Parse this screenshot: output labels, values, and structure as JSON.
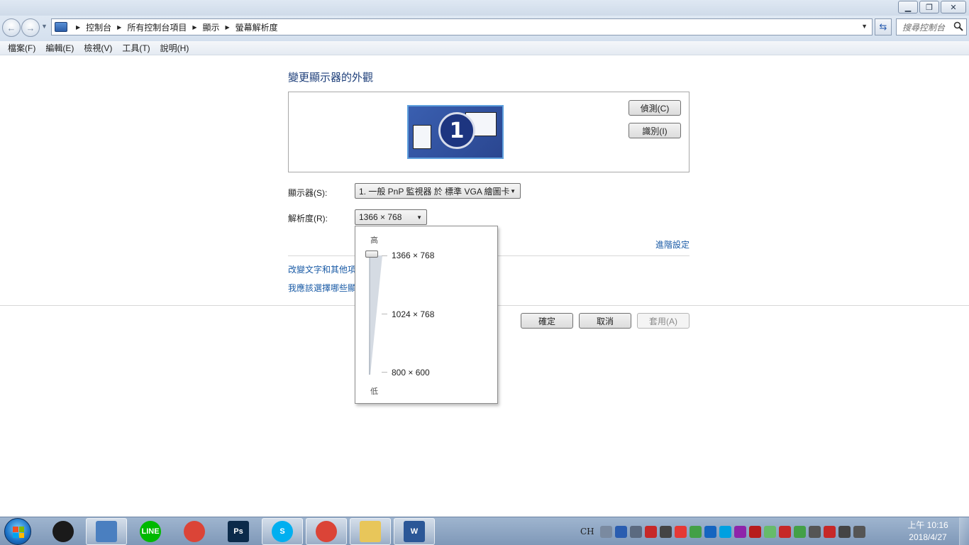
{
  "window": {
    "minimize_glyph": "▁",
    "restore_glyph": "❐",
    "close_glyph": "✕"
  },
  "address": {
    "back_glyph": "←",
    "forward_glyph": "→",
    "breadcrumb": [
      "控制台",
      "所有控制台項目",
      "顯示",
      "螢幕解析度"
    ],
    "search_placeholder": "搜尋控制台"
  },
  "menu": [
    "檔案(F)",
    "編輯(E)",
    "檢視(V)",
    "工具(T)",
    "說明(H)"
  ],
  "main": {
    "heading": "變更顯示器的外觀",
    "monitor_number": "1",
    "detect_button": "偵測(C)",
    "identify_button": "識別(I)",
    "display_label": "顯示器(S):",
    "display_value": "1. 一般 PnP 監視器 於 標準 VGA 繪圖卡",
    "resolution_label": "解析度(R):",
    "resolution_value": "1366 × 768",
    "advanced_link": "進階設定",
    "link_text_size": "改變文字和其他項",
    "link_which_display": "我應該選擇哪些顯",
    "ok_button": "確定",
    "cancel_button": "取消",
    "apply_button": "套用(A)"
  },
  "resolution_dropdown": {
    "high_label": "高",
    "low_label": "低",
    "options": [
      "1366 × 768",
      "1024 × 768",
      "800 × 600"
    ],
    "selected_index": 0
  },
  "taskbar": {
    "apps": [
      {
        "name": "clock-app",
        "label": "",
        "color": "#1a1a1a",
        "active": false
      },
      {
        "name": "control-panel",
        "label": "",
        "color": "#4a7fc0",
        "active": true
      },
      {
        "name": "line",
        "label": "LINE",
        "color": "#00b900",
        "active": false
      },
      {
        "name": "chrome",
        "label": "",
        "color": "#db4437",
        "active": false
      },
      {
        "name": "photoshop",
        "label": "Ps",
        "color": "#0b2a4a",
        "active": false
      },
      {
        "name": "skype",
        "label": "S",
        "color": "#00aff0",
        "active": true
      },
      {
        "name": "chrome-2",
        "label": "",
        "color": "#db4437",
        "active": true
      },
      {
        "name": "file-explorer",
        "label": "",
        "color": "#e8c65a",
        "active": true
      },
      {
        "name": "word",
        "label": "W",
        "color": "#2b5797",
        "active": true
      }
    ],
    "lang": "CH",
    "tray_colors": [
      "#7a8aa0",
      "#2a5db0",
      "#5b6a80",
      "#c62828",
      "#444444",
      "#e53935",
      "#43a047",
      "#1565c0",
      "#00a0e0",
      "#8e24aa",
      "#b71c1c",
      "#66bb6a",
      "#c62828",
      "#43a047",
      "#555555",
      "#c62828",
      "#444444",
      "#555555"
    ],
    "clock_time": "上午 10:16",
    "clock_date": "2018/4/27"
  }
}
